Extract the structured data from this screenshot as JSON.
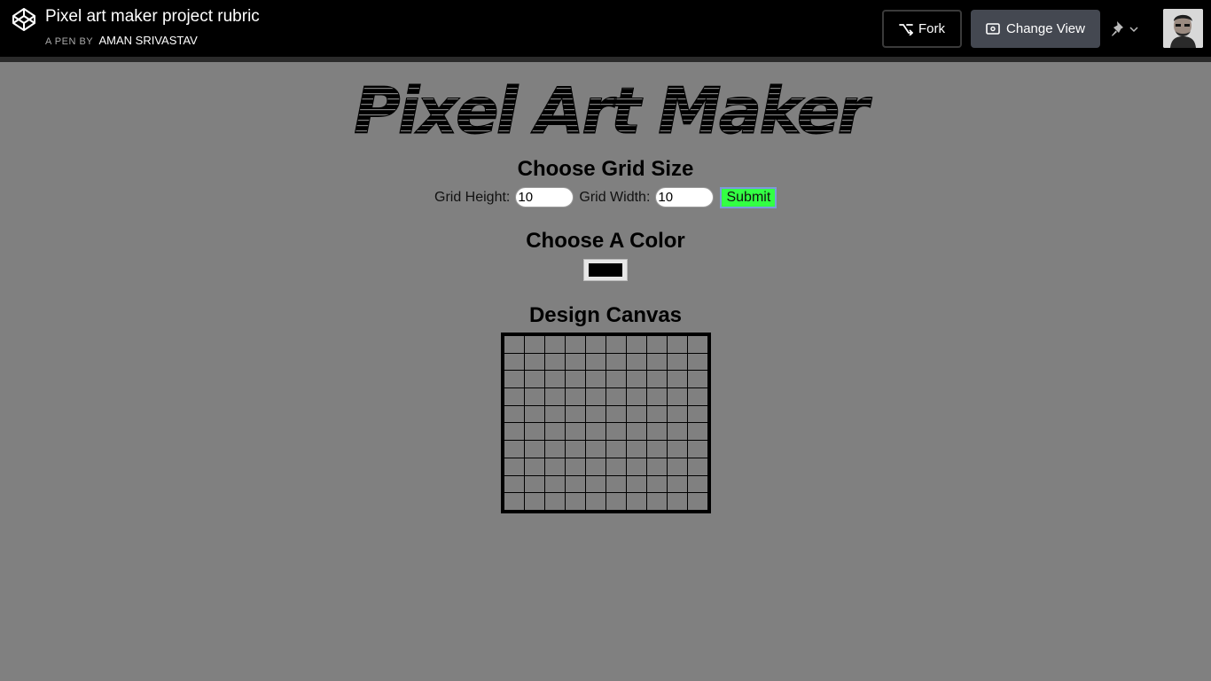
{
  "header": {
    "title": "Pixel art maker project rubric",
    "byline_prefix": "A PEN BY",
    "author": "AMAN SRIVASTAV",
    "fork_label": "Fork",
    "change_view_label": "Change View",
    "logo_icon": "codepen-logo-icon",
    "fork_icon": "fork-icon",
    "view_icon": "change-view-icon",
    "pin_icon": "pin-icon"
  },
  "main": {
    "title_art": "Pixel Art Maker",
    "grid_heading": "Choose Grid Size",
    "height_label": "Grid Height:",
    "height_value": "10",
    "width_label": "Grid Width:",
    "width_value": "10",
    "submit_label": "Submit",
    "color_heading": "Choose A Color",
    "selected_color": "#000000",
    "canvas_heading": "Design Canvas",
    "canvas_rows": 10,
    "canvas_cols": 10
  },
  "colors": {
    "page_bg": "#808080",
    "header_bg": "#000000",
    "submit_bg": "#33ff44"
  }
}
